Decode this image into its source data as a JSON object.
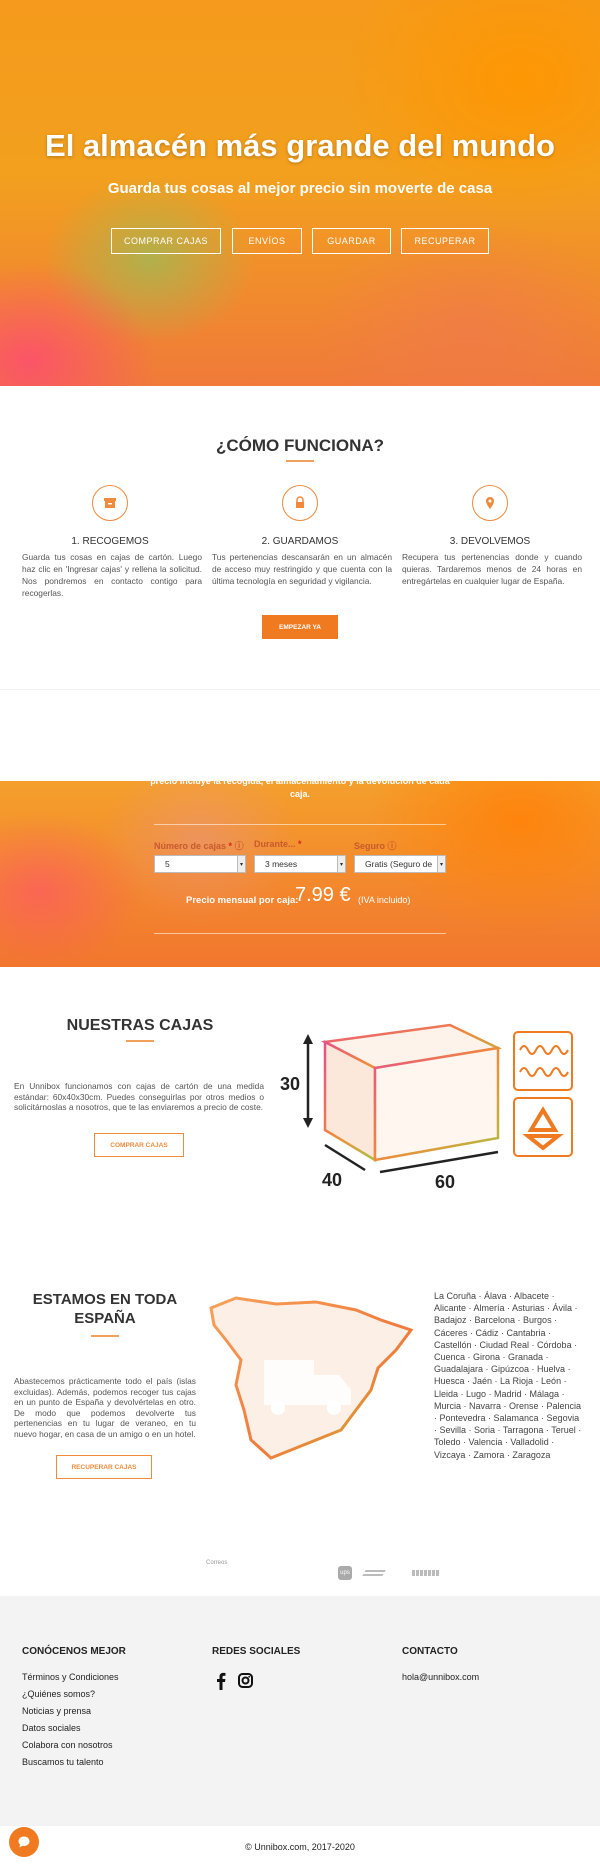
{
  "hero": {
    "title": "El almacén más grande del mundo",
    "subtitle": "Guarda tus cosas al mejor precio sin moverte de casa",
    "buttons": [
      "COMPRAR CAJAS",
      "ENVÍOS",
      "GUARDAR",
      "RECUPERAR"
    ]
  },
  "how": {
    "title": "¿CÓMO FUNCIONA?",
    "steps": [
      {
        "icon": "box-icon",
        "title": "1. RECOGEMOS",
        "text": "Guarda tus cosas en cajas de cartón. Luego haz clic en 'Ingresar cajas' y rellena la solicitud. Nos pondremos en contacto contigo para recogerlas."
      },
      {
        "icon": "lock-icon",
        "title": "2. GUARDAMOS",
        "text": "Tus pertenencias descansarán en un almacén de acceso muy restringido y que cuenta con la última tecnología en seguridad y vigilancia."
      },
      {
        "icon": "map-pin-icon",
        "title": "3. DEVOLVEMOS",
        "text": "Recupera tus pertenencias donde y cuando quieras. Tardaremos menos de 24 horas en entregártelas en cualquier lugar de España."
      }
    ],
    "cta": "EMPEZAR YA"
  },
  "pricing": {
    "intro": "precio incluye la recogida, el almacenamiento y la devolución de cada caja.",
    "fields": [
      {
        "label": "Número de cajas",
        "required": "*",
        "value": "5"
      },
      {
        "label": "Durante...",
        "required": "*",
        "value": "3 meses"
      },
      {
        "label": "Seguro",
        "required": "",
        "value": "Gratis (Seguro de"
      }
    ],
    "price_label": "Precio mensual por caja:",
    "price_value": "7.99 €",
    "price_note": "(IVA incluido)"
  },
  "boxes": {
    "title": "NUESTRAS CAJAS",
    "text": "En Unnibox funcionamos con cajas de cartón de una medida estándar: 60x40x30cm. Puedes conseguirlas por otros medios o solicitárnoslas a nosotros, que te las enviaremos a precio de coste.",
    "cta": "COMPRAR CAJAS",
    "dims": {
      "height": "30",
      "depth": "40",
      "width": "60"
    }
  },
  "spain": {
    "title_line1": "ESTAMOS EN TODA",
    "title_line2": "ESPAÑA",
    "text": "Abastecemos prácticamente todo el país (islas excluidas). Además, podemos recoger tus cajas en un punto de España y devolvértelas en otro. De modo que podemos devolverte tus pertenencias en tu lugar de veraneo, en tu nuevo hogar, en casa de un amigo o en un hotel.",
    "cta": "RECUPERAR CAJAS",
    "cities": "La Coruña · Álava · Albacete · Alicante · Almería · Asturias · Ávila · Badajoz · Barcelona · Burgos · Cáceres · Cádiz · Cantabria · Castellón · Ciudad Real · Córdoba · Cuenca · Girona · Granada · Guadalajara · Gipúzcoa · Huelva · Huesca · Jaén · La Rioja · León · Lleida · Lugo · Madrid · Málaga · Murcia · Navarra · Orense · Palencia · Pontevedra · Salamanca · Segovia · Sevilla · Soria · Tarragona · Teruel · Toledo · Valencia · Valladolid · Vizcaya · Zamora · Zaragoza"
  },
  "partners": {
    "correos": "Correos",
    "ups": "ups"
  },
  "footer": {
    "col1_title": "CONÓCENOS MEJOR",
    "col1_links": [
      "Términos y Condiciones",
      "¿Quiénes somos?",
      "Noticias y prensa",
      "Datos sociales",
      "Colabora con nosotros",
      "Buscamos tu talento"
    ],
    "col2_title": "REDES SOCIALES",
    "col3_title": "CONTACTO",
    "email": "hola@unnibox.com",
    "copyright": "© Unnibox.com, 2017-2020"
  },
  "colors": {
    "accent": "#f07a20",
    "heading": "#333333",
    "footer_bg": "#f3f3f3"
  }
}
